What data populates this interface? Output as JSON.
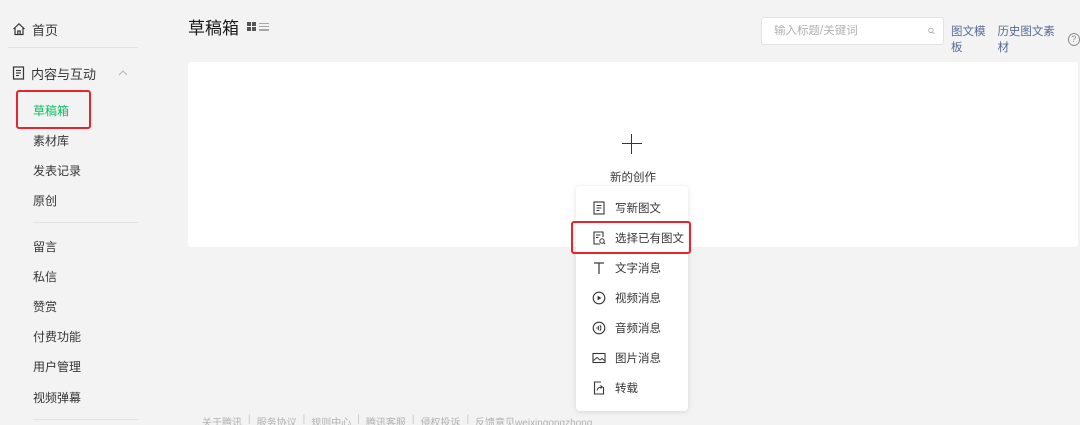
{
  "sidebar": {
    "home_label": "首页",
    "section_label": "内容与互动",
    "section_items": [
      {
        "label": "草稿箱",
        "active": true
      },
      {
        "label": "素材库"
      },
      {
        "label": "发表记录"
      },
      {
        "label": "原创"
      }
    ],
    "interaction_items": [
      {
        "label": "留言"
      },
      {
        "label": "私信"
      },
      {
        "label": "赞赏"
      },
      {
        "label": "付费功能"
      },
      {
        "label": "用户管理"
      },
      {
        "label": "视频弹幕"
      }
    ]
  },
  "header": {
    "title": "草稿箱",
    "search_placeholder": "输入标题/关键词",
    "links": [
      "图文模板",
      "历史图文素材"
    ],
    "help": "?"
  },
  "main": {
    "new_creation_label": "新的创作",
    "menu": [
      {
        "label": "写新图文",
        "icon": "doc-icon"
      },
      {
        "label": "选择已有图文",
        "icon": "doc-search-icon",
        "highlighted": true
      },
      {
        "label": "文字消息",
        "icon": "text-icon"
      },
      {
        "label": "视频消息",
        "icon": "play-icon"
      },
      {
        "label": "音频消息",
        "icon": "audio-icon"
      },
      {
        "label": "图片消息",
        "icon": "image-icon"
      },
      {
        "label": "转载",
        "icon": "repost-icon"
      }
    ]
  },
  "footer": {
    "links": [
      "关于腾讯",
      "服务协议",
      "规则中心",
      "腾讯客服",
      "侵权投诉",
      "反馈意见weixingongzhong"
    ]
  },
  "colors": {
    "accent_green": "#07c160",
    "highlight_red": "#e5262d",
    "link_blue": "#576b95"
  }
}
